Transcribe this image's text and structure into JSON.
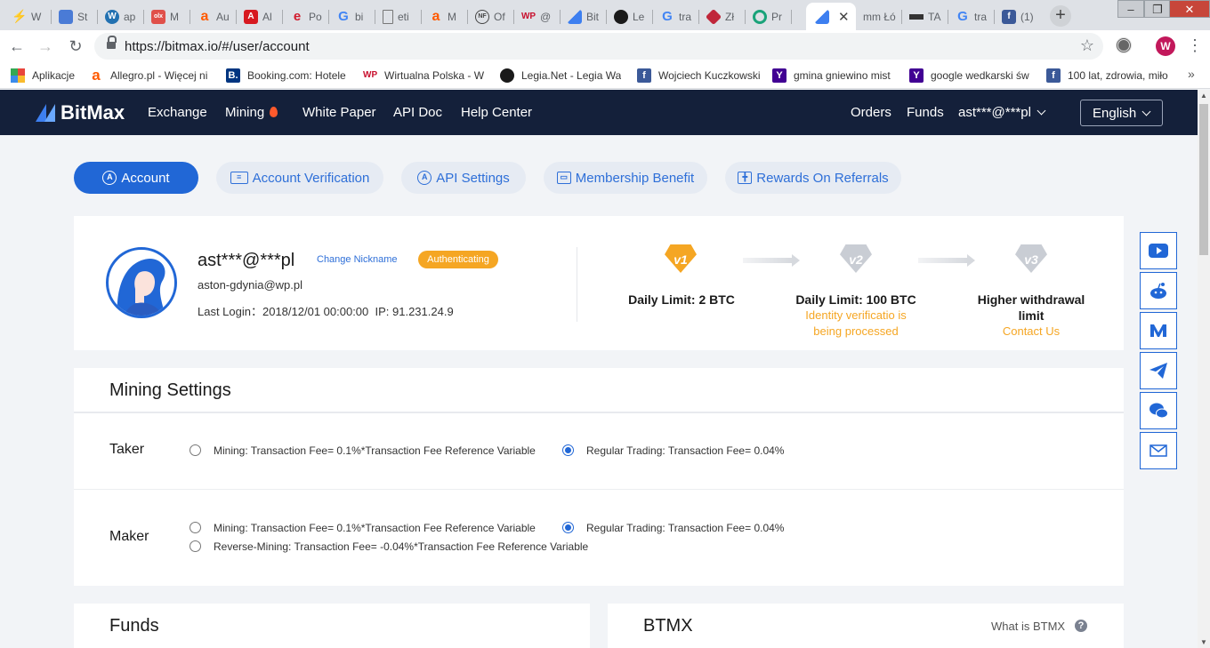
{
  "browser": {
    "tabs": [
      {
        "label": "W",
        "icon": "lightning-icon",
        "color": "#333333"
      },
      {
        "label": "St",
        "icon": "robot-icon",
        "color": "#4a7bd6"
      },
      {
        "label": "ap",
        "icon": "wordpress-icon",
        "color": "#2271b1"
      },
      {
        "label": "M",
        "icon": "olx-icon",
        "color": "#e0504a"
      },
      {
        "label": "Au",
        "icon": "allegro-icon",
        "color": "#ff5a00"
      },
      {
        "label": "Al",
        "icon": "acrobat-icon",
        "color": "#d71920"
      },
      {
        "label": "Po",
        "icon": "e-icon",
        "color": "#d21b2d"
      },
      {
        "label": "bi",
        "icon": "google-icon",
        "color": "#4285f4"
      },
      {
        "label": "eti",
        "icon": "doc-icon",
        "color": "#777777"
      },
      {
        "label": "M",
        "icon": "allegro-icon",
        "color": "#ff5a00"
      },
      {
        "label": "Of",
        "icon": "nf-icon",
        "color": "#444444"
      },
      {
        "label": "@",
        "icon": "wp-icon",
        "color": "#c8102e"
      },
      {
        "label": "Bit",
        "icon": "bitmax-icon",
        "color": "#3d7ff0"
      },
      {
        "label": "Le",
        "icon": "legia-icon",
        "color": "#1a1a1a"
      },
      {
        "label": "tra",
        "icon": "google-icon",
        "color": "#4285f4"
      },
      {
        "label": "Zł",
        "icon": "cube-icon",
        "color": "#c0263a"
      },
      {
        "label": "Pr",
        "icon": "circle-app-icon",
        "color": "#1aa37a"
      },
      {
        "label": "",
        "icon": "bitmax-icon",
        "color": "#3d7ff0",
        "active": true
      },
      {
        "label": "mm Łó",
        "icon": "",
        "color": "#777777"
      },
      {
        "label": "TA",
        "icon": "bar-icon",
        "color": "#333333"
      },
      {
        "label": "tra",
        "icon": "google-icon",
        "color": "#4285f4"
      },
      {
        "label": "(1)",
        "icon": "facebook-icon",
        "color": "#3b5998"
      }
    ],
    "url": "https://bitmax.io/#/user/account",
    "profile_initial": "W",
    "bookmarks": [
      {
        "label": "Aplikacje",
        "icon": "apps-grid-icon",
        "color": "#e8453c"
      },
      {
        "label": "Allegro.pl - Więcej ni",
        "icon": "allegro-icon",
        "color": "#ff5a00"
      },
      {
        "label": "Booking.com: Hotele",
        "icon": "booking-icon",
        "color": "#003580"
      },
      {
        "label": "Wirtualna Polska - W",
        "icon": "wp-icon",
        "color": "#c8102e"
      },
      {
        "label": "Legia.Net - Legia Wa",
        "icon": "legia-icon",
        "color": "#1a1a1a"
      },
      {
        "label": "Wojciech Kuczkowski",
        "icon": "facebook-icon",
        "color": "#3b5998"
      },
      {
        "label": "gmina gniewino mist",
        "icon": "yahoo-icon",
        "color": "#410093"
      },
      {
        "label": "google wedkarski św",
        "icon": "yahoo-icon",
        "color": "#410093"
      },
      {
        "label": "100 lat, zdrowia, miło",
        "icon": "facebook-icon",
        "color": "#3b5998"
      }
    ]
  },
  "header": {
    "brand": "BitMax",
    "nav": [
      "Exchange",
      "Mining",
      "White Paper",
      "API Doc",
      "Help Center"
    ],
    "orders": "Orders",
    "funds": "Funds",
    "user": "ast***@***pl",
    "language": "English"
  },
  "tabs": [
    {
      "label": "Account",
      "icon": "account-icon",
      "active": true
    },
    {
      "label": "Account Verification",
      "icon": "id-card-icon"
    },
    {
      "label": "API Settings",
      "icon": "api-icon"
    },
    {
      "label": "Membership Benefit",
      "icon": "card-icon"
    },
    {
      "label": "Rewards On Referrals",
      "icon": "gift-icon"
    }
  ],
  "profile": {
    "nickname": "ast***@***pl",
    "change_nickname": "Change Nickname",
    "status": "Authenticating",
    "email": "aston-gdynia@wp.pl",
    "last_login": "Last Login：2018/12/01 00:00:00  IP: 91.231.24.9"
  },
  "levels": [
    {
      "badge": "v1",
      "title": "Daily Limit: 2 BTC",
      "sub": "",
      "color": "#f5a623"
    },
    {
      "badge": "v2",
      "title": "Daily Limit: 100 BTC",
      "sub": "Identity verificatio is being processed",
      "color": "#c9cdd4"
    },
    {
      "badge": "v3",
      "title": "Higher withdrawal limit",
      "sub": "Contact Us",
      "color": "#c9cdd4"
    }
  ],
  "mining": {
    "title": "Mining Settings",
    "taker": {
      "label": "Taker",
      "options": [
        "Mining: Transaction Fee= 0.1%*Transaction Fee Reference Variable",
        "Regular Trading: Transaction Fee= 0.04%"
      ],
      "selected": 1
    },
    "maker": {
      "label": "Maker",
      "options": [
        "Mining: Transaction Fee= 0.1%*Transaction Fee Reference Variable",
        "Regular Trading: Transaction Fee= 0.04%",
        "Reverse-Mining: Transaction Fee= -0.04%*Transaction Fee Reference Variable"
      ],
      "selected": 1
    }
  },
  "funds": {
    "title": "Funds"
  },
  "btmx": {
    "title": "BTMX",
    "what_is": "What is BTMX",
    "help": "?"
  },
  "social": [
    "youtube-icon",
    "reddit-icon",
    "medium-icon",
    "telegram-icon",
    "wechat-icon",
    "mail-icon"
  ],
  "colors": {
    "accent": "#2167d6",
    "header_bg": "#14203a",
    "warning": "#f5a623",
    "page_bg": "#f2f4f7"
  }
}
